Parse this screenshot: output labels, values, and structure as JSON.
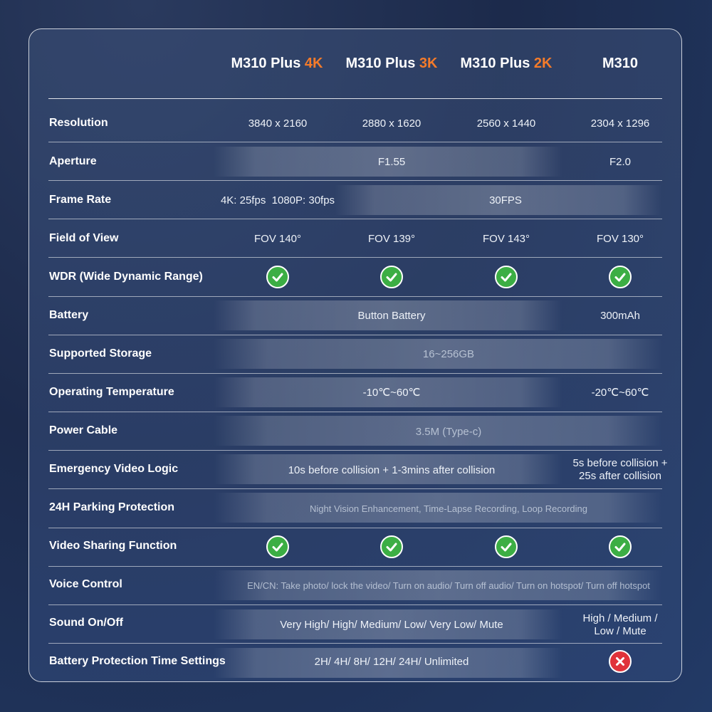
{
  "columns": [
    {
      "base": "M310 Plus ",
      "accent": "4K"
    },
    {
      "base": "M310 Plus ",
      "accent": "3K"
    },
    {
      "base": "M310 Plus ",
      "accent": "2K"
    },
    {
      "base": "M310",
      "accent": ""
    }
  ],
  "accent_color": "#f47b2a",
  "rows": {
    "resolution": {
      "label": "Resolution",
      "c1": "3840 x 2160",
      "c2": "2880 x 1620",
      "c3": "2560 x 1440",
      "c4": "2304 x 1296"
    },
    "aperture": {
      "label": "Aperture",
      "span": "F1.55",
      "c4": "F2.0"
    },
    "frame_rate": {
      "label": "Frame Rate",
      "c1": "4K: 25fps  1080P: 30fps",
      "span": "30FPS"
    },
    "fov": {
      "label": "Field of View",
      "c1": "FOV 140°",
      "c2": "FOV 139°",
      "c3": "FOV 143°",
      "c4": "FOV 130°"
    },
    "wdr": {
      "label": "WDR (Wide Dynamic Range)",
      "icon": "check-icon"
    },
    "battery": {
      "label": "Battery",
      "span": "Button Battery",
      "c4": "300mAh"
    },
    "storage": {
      "label": "Supported Storage",
      "span": "16~256GB"
    },
    "temperature": {
      "label": "Operating Temperature",
      "span": "-10℃~60℃",
      "c4": "-20℃~60℃"
    },
    "power": {
      "label": "Power Cable",
      "span": "3.5M (Type-c)"
    },
    "emergency": {
      "label": "Emergency Video Logic",
      "span": "10s before collision + 1-3mins after collision",
      "c4_line1": "5s before collision +",
      "c4_line2": "25s after collision"
    },
    "parking": {
      "label": "24H Parking Protection",
      "span": "Night Vision Enhancement, Time-Lapse Recording, Loop Recording"
    },
    "sharing": {
      "label": "Video Sharing Function",
      "icon": "check-icon"
    },
    "voice": {
      "label": "Voice Control",
      "span": "EN/CN: Take photo/ lock the video/ Turn on audio/ Turn off audio/ Turn on hotspot/ Turn off hotspot"
    },
    "sound": {
      "label": "Sound On/Off",
      "span": "Very High/ High/ Medium/ Low/ Very Low/ Mute",
      "c4_line1": "High / Medium /",
      "c4_line2": "Low / Mute"
    },
    "battery_protection": {
      "label": "Battery Protection Time Settings",
      "span": "2H/ 4H/ 8H/ 12H/ 24H/ Unlimited",
      "c4_icon": "cross-icon"
    }
  },
  "colors": {
    "check": "#3cae44",
    "cross": "#e0323a"
  }
}
